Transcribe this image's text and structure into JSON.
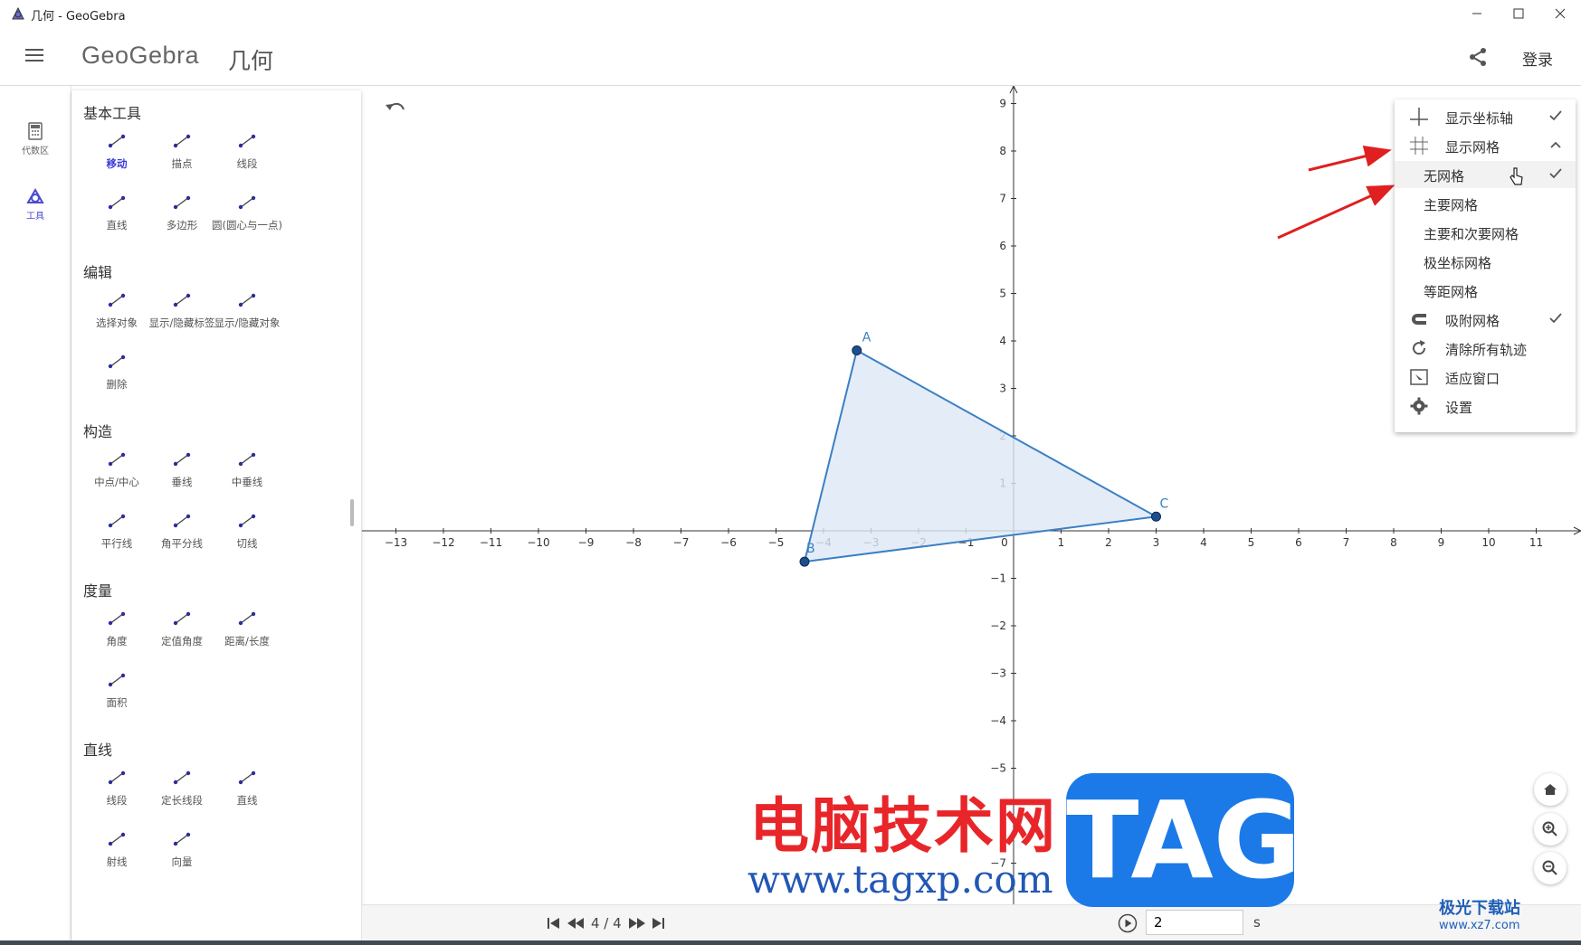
{
  "window": {
    "title": "几何 - GeoGebra"
  },
  "header": {
    "logo": "GeoGebra",
    "app_name": "几何",
    "login": "登录"
  },
  "rail": {
    "algebra": "代数区",
    "tools": "工具"
  },
  "tools_panel": {
    "categories": [
      {
        "title": "基本工具",
        "tools": [
          "移动",
          "描点",
          "线段",
          "直线",
          "多边形",
          "圆(圆心与一点)"
        ]
      },
      {
        "title": "编辑",
        "tools": [
          "选择对象",
          "显示/隐藏标签",
          "显示/隐藏对象",
          "删除"
        ]
      },
      {
        "title": "构造",
        "tools": [
          "中点/中心",
          "垂线",
          "中垂线",
          "平行线",
          "角平分线",
          "切线"
        ]
      },
      {
        "title": "度量",
        "tools": [
          "角度",
          "定值角度",
          "距离/长度",
          "面积"
        ]
      },
      {
        "title": "直线",
        "tools": [
          "线段",
          "定长线段",
          "直线",
          "射线",
          "向量"
        ]
      }
    ]
  },
  "graphics": {
    "x_ticks": [
      "−13",
      "−12",
      "−11",
      "−10",
      "−9",
      "−8",
      "−7",
      "−6",
      "−5",
      "−4",
      "−3",
      "−2",
      "−1",
      "0",
      "1",
      "2",
      "3",
      "4",
      "5",
      "6",
      "7",
      "8",
      "9",
      "10",
      "11"
    ],
    "y_ticks_pos": [
      "1",
      "2",
      "3",
      "4",
      "5",
      "6",
      "7",
      "8",
      "9"
    ],
    "y_ticks_neg": [
      "−1",
      "−2",
      "−3",
      "−4",
      "−5",
      "−7"
    ],
    "points": [
      {
        "label": "A",
        "x": -3.3,
        "y": 3.8
      },
      {
        "label": "B",
        "x": -4.4,
        "y": -0.65
      },
      {
        "label": "C",
        "x": 3.0,
        "y": 0.3
      }
    ],
    "colors": {
      "polygon_stroke": "#3b7fc4",
      "polygon_fill": "#dde8f5",
      "point": "#1f4e8c"
    }
  },
  "context_menu": {
    "items": [
      {
        "label": "显示坐标轴",
        "icon": "axes-icon",
        "checked": true
      },
      {
        "label": "显示网格",
        "icon": "grid-icon",
        "expanded": true
      },
      {
        "label": "无网格",
        "sub": true,
        "checked": true
      },
      {
        "label": "主要网格",
        "sub": true
      },
      {
        "label": "主要和次要网格",
        "sub": true
      },
      {
        "label": "极坐标网格",
        "sub": true
      },
      {
        "label": "等距网格",
        "sub": true
      },
      {
        "label": "吸附网格",
        "icon": "magnet-icon",
        "checked": true
      },
      {
        "label": "清除所有轨迹",
        "icon": "refresh-icon"
      },
      {
        "label": "适应窗口",
        "icon": "fit-window-icon"
      },
      {
        "label": "设置",
        "icon": "gear-icon"
      }
    ]
  },
  "animation_bar": {
    "step": "4 / 4",
    "speed_value": "2",
    "speed_unit": "s"
  },
  "watermark": {
    "cn": "电脑技术网",
    "url": "www.tagxp.com",
    "tag": "TAG",
    "corner_cn": "极光下载站",
    "corner_url": "www.xz7.com"
  }
}
